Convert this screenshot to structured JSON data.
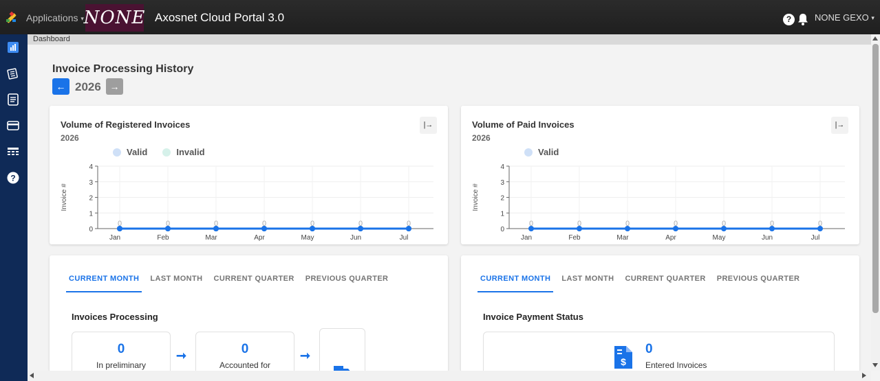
{
  "header": {
    "apps_label": "Applications",
    "brand_text": "NONE",
    "portal_title": "Axosnet Cloud Portal 3.0",
    "user_name": "NONE GEXO"
  },
  "breadcrumb": "Dashboard",
  "page": {
    "heading": "Invoice Processing History",
    "year": "2026",
    "prev_label": "←",
    "next_label": "→"
  },
  "registered_card": {
    "title": "Volume of Registered Invoices",
    "subtitle": "2026",
    "legend": [
      {
        "name": "Valid",
        "color": "#cfe0f7"
      },
      {
        "name": "Invalid",
        "color": "#d6f1ea"
      }
    ]
  },
  "paid_card": {
    "title": "Volume of Paid Invoices",
    "subtitle": "2026",
    "legend": [
      {
        "name": "Valid",
        "color": "#cfe0f7"
      }
    ]
  },
  "chart_data": [
    {
      "type": "line",
      "title": "Volume of Registered Invoices",
      "ylabel": "Invoice #",
      "categories": [
        "Jan",
        "Feb",
        "Mar",
        "Apr",
        "May",
        "Jun",
        "Jul"
      ],
      "ylim": [
        0,
        4
      ],
      "yticks": [
        0,
        1,
        2,
        3,
        4
      ],
      "series": [
        {
          "name": "Valid",
          "values": [
            0,
            0,
            0,
            0,
            0,
            0,
            0
          ]
        },
        {
          "name": "Invalid",
          "values": [
            0,
            0,
            0,
            0,
            0,
            0,
            0
          ]
        }
      ],
      "data_labels": [
        "0",
        "0",
        "0",
        "0",
        "0",
        "0",
        "0"
      ],
      "grid": true
    },
    {
      "type": "line",
      "title": "Volume of Paid Invoices",
      "ylabel": "Invoice #",
      "categories": [
        "Jan",
        "Feb",
        "Mar",
        "Apr",
        "May",
        "Jun",
        "Jul"
      ],
      "ylim": [
        0,
        4
      ],
      "yticks": [
        0,
        1,
        2,
        3,
        4
      ],
      "series": [
        {
          "name": "Valid",
          "values": [
            0,
            0,
            0,
            0,
            0,
            0,
            0
          ]
        }
      ],
      "data_labels": [
        "0",
        "0",
        "0",
        "0",
        "0",
        "0",
        "0"
      ],
      "grid": true
    }
  ],
  "tabs": [
    "CURRENT MONTH",
    "LAST MONTH",
    "CURRENT QUARTER",
    "PREVIOUS QUARTER"
  ],
  "processing": {
    "title": "Invoices Processing",
    "steps": [
      {
        "value": "0",
        "label": "In preliminary"
      },
      {
        "value": "0",
        "label": "Accounted for"
      }
    ]
  },
  "payment": {
    "title": "Invoice Payment Status",
    "entered_value": "0",
    "entered_label": "Entered Invoices"
  },
  "colors": {
    "accent": "#1a73e8",
    "sidebar": "#0f2a57",
    "brand": "#4a1232"
  }
}
